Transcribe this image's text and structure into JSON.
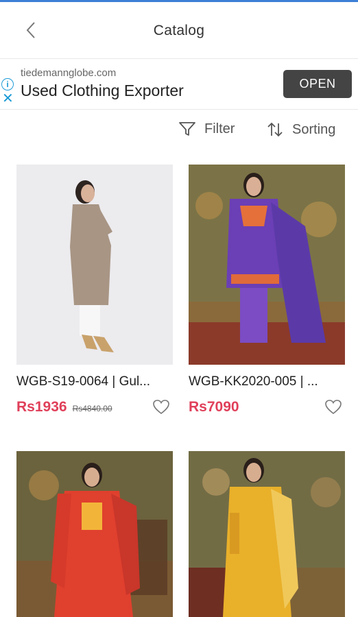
{
  "header": {
    "title": "Catalog"
  },
  "ad": {
    "domain": "tiedemannglobe.com",
    "headline": "Used Clothing Exporter",
    "cta": "OPEN"
  },
  "toolbar": {
    "filter_label": "Filter",
    "sort_label": "Sorting"
  },
  "products": [
    {
      "name": "WGB-S19-0064 | Gul...",
      "price": "Rs1936",
      "old_price": "Rs4840.00"
    },
    {
      "name": "WGB-KK2020-005 | ...",
      "price": "Rs7090",
      "old_price": ""
    },
    {
      "name": "",
      "price": "",
      "old_price": ""
    },
    {
      "name": "",
      "price": "",
      "old_price": ""
    }
  ],
  "colors": {
    "accent": "#e0405a",
    "ad_button": "#444444",
    "ad_icon": "#1a9ad6"
  }
}
